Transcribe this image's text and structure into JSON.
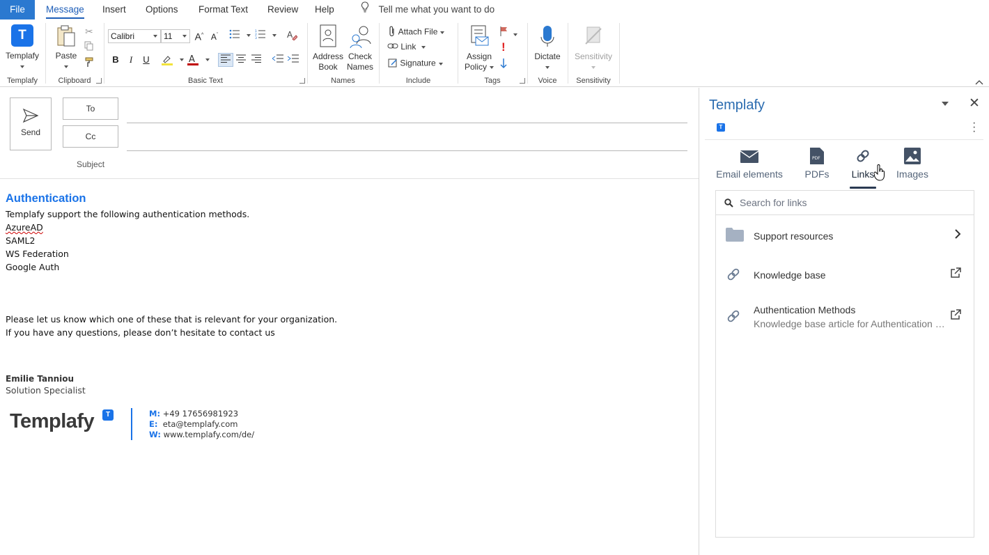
{
  "tabs": {
    "file": "File",
    "items": [
      "Message",
      "Insert",
      "Options",
      "Format Text",
      "Review",
      "Help"
    ],
    "active": "Message",
    "tell_me": "Tell me what you want to do"
  },
  "ribbon": {
    "templafy": {
      "button": "Templafy",
      "group": "Templafy"
    },
    "clipboard": {
      "paste": "Paste",
      "group": "Clipboard"
    },
    "basic_text": {
      "font_name": "Calibri",
      "font_size": "11",
      "bold": "B",
      "italic": "I",
      "underline": "U",
      "group": "Basic Text"
    },
    "names": {
      "address_book_1": "Address",
      "address_book_2": "Book",
      "check_names_1": "Check",
      "check_names_2": "Names",
      "group": "Names"
    },
    "include": {
      "attach_file": "Attach File",
      "link": "Link",
      "signature": "Signature",
      "group": "Include"
    },
    "assign_policy": {
      "line1": "Assign",
      "line2": "Policy",
      "group": "Tags"
    },
    "voice": {
      "dictate": "Dictate",
      "group": "Voice"
    },
    "sensitivity": {
      "button": "Sensitivity",
      "group": "Sensitivity"
    },
    "accent_color": "#2b79d0"
  },
  "compose": {
    "send": "Send",
    "to": "To",
    "cc": "Cc",
    "subject": "Subject",
    "heading": "Authentication",
    "intro": "Templafy support the following authentication methods.",
    "methods": [
      "AzureAD",
      "SAML2",
      "WS Federation",
      "Google Auth"
    ],
    "para1": "Please let us know which one of these that is relevant for your organization.",
    "para2": "If you have any questions, please don’t hesitate to contact us",
    "signature": {
      "name": "Emilie Tanniou",
      "title": "Solution Specialist",
      "logo": "Templafy",
      "m_label": "M:",
      "mobile": "+49 17656981923",
      "e_label": "E:",
      "email": "eta@templafy.com",
      "w_label": "W:",
      "web": "www.templafy.com/de/"
    }
  },
  "pane": {
    "title": "Templafy",
    "tabs": [
      "Email elements",
      "PDFs",
      "Links",
      "Images"
    ],
    "active_tab": "Links",
    "search_placeholder": "Search for links",
    "items": [
      {
        "title": "Support resources",
        "subtitle": "",
        "icon": "folder-icon",
        "trail": "chevron-right-icon"
      },
      {
        "title": "Knowledge base",
        "subtitle": "",
        "icon": "link-icon",
        "trail": "external-link-icon"
      },
      {
        "title": "Authentication Methods",
        "subtitle": "Knowledge base article for Authentication methods",
        "icon": "link-icon",
        "trail": "external-link-icon"
      }
    ],
    "title_color": "#2b6cb0"
  }
}
